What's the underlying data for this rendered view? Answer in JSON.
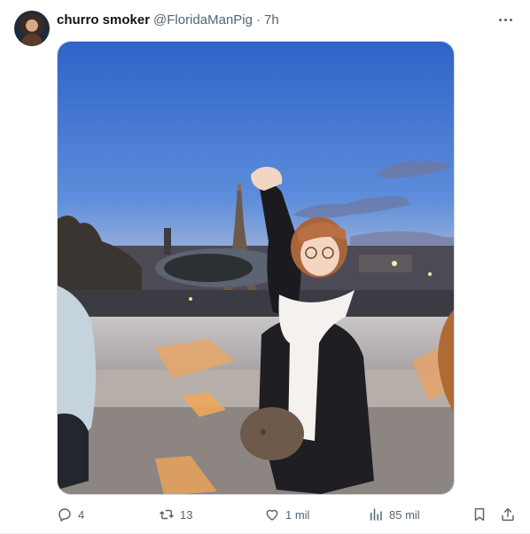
{
  "post": {
    "display_name": "churro smoker",
    "handle": "@FloridaManPig",
    "separator": "·",
    "time": "7h"
  },
  "actions": {
    "replies": "4",
    "reposts": "13",
    "likes": "1 mil",
    "views": "85 mil"
  },
  "icons": {
    "more": "more-horizontal-icon",
    "reply": "reply-icon",
    "repost": "repost-icon",
    "like": "heart-icon",
    "views": "views-chart-icon",
    "bookmark": "bookmark-icon",
    "share": "share-icon"
  },
  "colors": {
    "text_primary": "#0f1419",
    "text_secondary": "#536471",
    "border": "#cfd9de"
  }
}
